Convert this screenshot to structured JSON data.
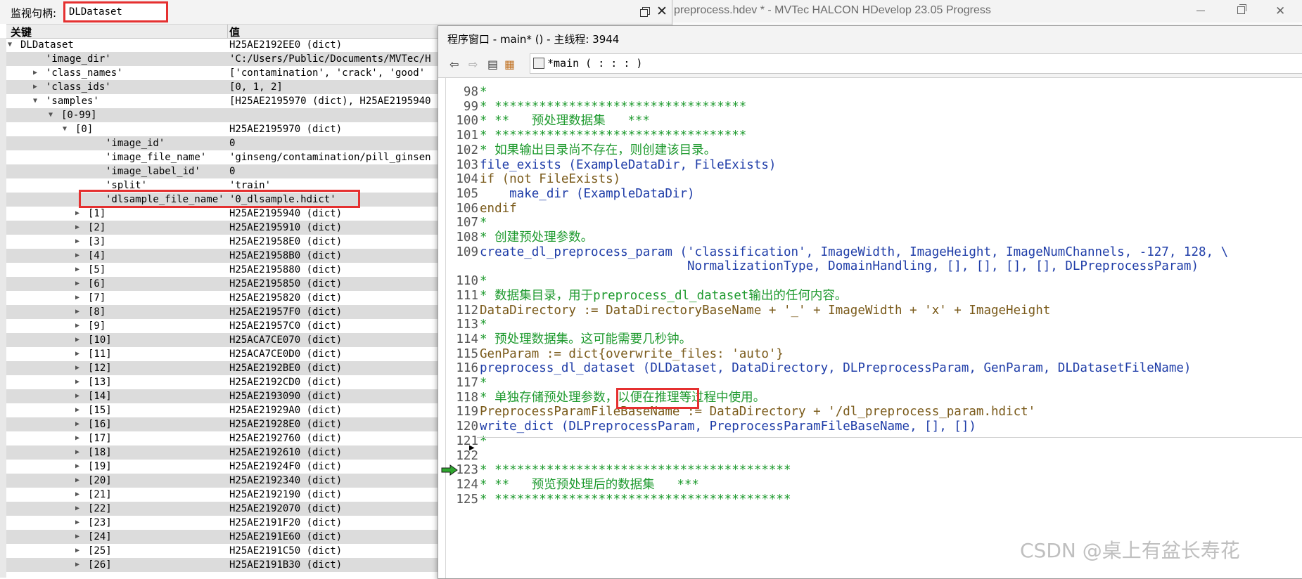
{
  "main_window": {
    "title": "preprocess.hdev * - MVTec HALCON HDevelop 23.05 Progress"
  },
  "watch_window": {
    "handle_label": "监视句柄:",
    "handle_value": "DLDataset",
    "col_key": "关键",
    "col_value": "值",
    "rows": [
      {
        "key": "DLDataset",
        "value": "H25AE2192EE0 (dict)"
      },
      {
        "key": "'image_dir'",
        "value": "'C:/Users/Public/Documents/MVTec/H"
      },
      {
        "key": "'class_names'",
        "value": "['contamination', 'crack', 'good'"
      },
      {
        "key": "'class_ids'",
        "value": "[0, 1, 2]"
      },
      {
        "key": "'samples'",
        "value": "[H25AE2195970 (dict), H25AE2195940"
      },
      {
        "key": "[0-99]",
        "value": ""
      },
      {
        "key": "[0]",
        "value": "H25AE2195970 (dict)"
      },
      {
        "key": "'image_id'",
        "value": "0"
      },
      {
        "key": "'image_file_name'",
        "value": "'ginseng/contamination/pill_ginsen"
      },
      {
        "key": "'image_label_id'",
        "value": "0"
      },
      {
        "key": "'split'",
        "value": "'train'"
      },
      {
        "key": "'dlsample_file_name'",
        "value": "'0_dlsample.hdict'"
      },
      {
        "key": "[1]",
        "value": "H25AE2195940 (dict)"
      },
      {
        "key": "[2]",
        "value": "H25AE2195910 (dict)"
      },
      {
        "key": "[3]",
        "value": "H25AE21958E0 (dict)"
      },
      {
        "key": "[4]",
        "value": "H25AE21958B0 (dict)"
      },
      {
        "key": "[5]",
        "value": "H25AE2195880 (dict)"
      },
      {
        "key": "[6]",
        "value": "H25AE2195850 (dict)"
      },
      {
        "key": "[7]",
        "value": "H25AE2195820 (dict)"
      },
      {
        "key": "[8]",
        "value": "H25AE21957F0 (dict)"
      },
      {
        "key": "[9]",
        "value": "H25AE21957C0 (dict)"
      },
      {
        "key": "[10]",
        "value": "H25ACA7CE070 (dict)"
      },
      {
        "key": "[11]",
        "value": "H25ACA7CE0D0 (dict)"
      },
      {
        "key": "[12]",
        "value": "H25AE2192BE0 (dict)"
      },
      {
        "key": "[13]",
        "value": "H25AE2192CD0 (dict)"
      },
      {
        "key": "[14]",
        "value": "H25AE2193090 (dict)"
      },
      {
        "key": "[15]",
        "value": "H25AE21929A0 (dict)"
      },
      {
        "key": "[16]",
        "value": "H25AE21928E0 (dict)"
      },
      {
        "key": "[17]",
        "value": "H25AE2192760 (dict)"
      },
      {
        "key": "[18]",
        "value": "H25AE2192610 (dict)"
      },
      {
        "key": "[19]",
        "value": "H25AE21924F0 (dict)"
      },
      {
        "key": "[20]",
        "value": "H25AE2192340 (dict)"
      },
      {
        "key": "[21]",
        "value": "H25AE2192190 (dict)"
      },
      {
        "key": "[22]",
        "value": "H25AE2192070 (dict)"
      },
      {
        "key": "[23]",
        "value": "H25AE2191F20 (dict)"
      },
      {
        "key": "[24]",
        "value": "H25AE2191E60 (dict)"
      },
      {
        "key": "[25]",
        "value": "H25AE2191C50 (dict)"
      },
      {
        "key": "[26]",
        "value": "H25AE2191B30 (dict)"
      }
    ]
  },
  "program_window": {
    "title": "程序窗口 - main* () - 主线程: 3944",
    "procedure": "*main ( : : : )",
    "lines": [
      {
        "n": "98",
        "t": "*"
      },
      {
        "n": "99",
        "t": "* **********************************"
      },
      {
        "n": "100",
        "t": "* **   预处理数据集   ***"
      },
      {
        "n": "101",
        "t": "* **********************************"
      },
      {
        "n": "102",
        "t": "* 如果输出目录尚不存在，则创建该目录。"
      },
      {
        "n": "103",
        "t": "file_exists (ExampleDataDir, FileExists)"
      },
      {
        "n": "104",
        "t": "if (not FileExists)"
      },
      {
        "n": "105",
        "t": "    make_dir (ExampleDataDir)"
      },
      {
        "n": "106",
        "t": "endif"
      },
      {
        "n": "107",
        "t": "*"
      },
      {
        "n": "108",
        "t": "* 创建预处理参数。"
      },
      {
        "n": "109",
        "t": "create_dl_preprocess_param ('classification', ImageWidth, ImageHeight, ImageNumChannels, -127, 128, \\"
      },
      {
        "n": "",
        "t": "                            NormalizationType, DomainHandling, [], [], [], [], DLPreprocessParam)"
      },
      {
        "n": "110",
        "t": "*"
      },
      {
        "n": "111",
        "t": "* 数据集目录，用于preprocess_dl_dataset输出的任何内容。"
      },
      {
        "n": "112",
        "t": "DataDirectory := DataDirectoryBaseName + '_' + ImageWidth + 'x' + ImageHeight"
      },
      {
        "n": "113",
        "t": "*"
      },
      {
        "n": "114",
        "t": "* 预处理数据集。这可能需要几秒钟。"
      },
      {
        "n": "115",
        "t": "GenParam := dict{overwrite_files: 'auto'}"
      },
      {
        "n": "116",
        "t": "preprocess_dl_dataset (DLDataset, DataDirectory, DLPreprocessParam, GenParam, DLDatasetFileName)"
      },
      {
        "n": "117",
        "t": "*"
      },
      {
        "n": "118",
        "t": "* 单独存储预处理参数，以便在推理等过程中使用。"
      },
      {
        "n": "119",
        "t": "PreprocessParamFileBaseName := DataDirectory + '/dl_preprocess_param.hdict'"
      },
      {
        "n": "120",
        "t": "write_dict (DLPreprocessParam, PreprocessParamFileBaseName, [], [])"
      },
      {
        "n": "121",
        "t": "*"
      },
      {
        "n": "122",
        "t": ""
      },
      {
        "n": "123",
        "t": "* ****************************************"
      },
      {
        "n": "124",
        "t": "* **   预览预处理后的数据集   ***"
      },
      {
        "n": "125",
        "t": "* ****************************************"
      }
    ]
  },
  "watermark": "CSDN @桌上有盆长寿花",
  "colors": {
    "highlight": "#e53030",
    "comment": "#1e9a2e",
    "operator": "#1f3da8",
    "control": "#7a5a1a"
  }
}
